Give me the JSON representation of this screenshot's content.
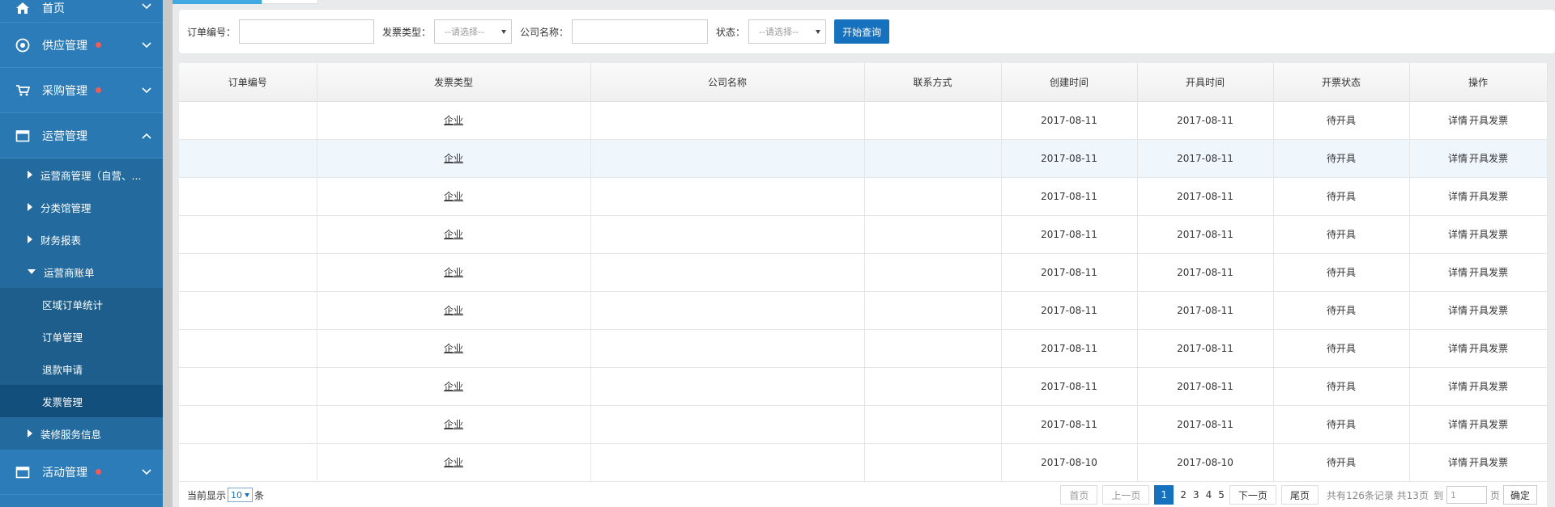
{
  "sidebar": {
    "home": "首页",
    "supply": "供应管理",
    "purchase": "采购管理",
    "operations": "运营管理",
    "operations_children": {
      "operator_mgmt": "运营商管理（自营、...",
      "category_mgmt": "分类馆管理",
      "finance": "财务报表",
      "operator_bill": "运营商账单",
      "bill_children": [
        "区域订单统计",
        "订单管理",
        "退款申请",
        "发票管理"
      ],
      "decoration": "装修服务信息"
    },
    "activity": "活动管理"
  },
  "filters": {
    "order_no_label": "订单编号：",
    "invoice_type_label": "发票类型：",
    "invoice_type_value": "--请选择--",
    "company_label": "公司名称：",
    "status_label": "状态：",
    "status_value": "--请选择--",
    "query_button": "开始查询"
  },
  "table": {
    "headers": [
      "订单编号",
      "发票类型",
      "公司名称",
      "联系方式",
      "创建时间",
      "开具时间",
      "开票状态",
      "操作"
    ],
    "rows": [
      {
        "order_no": "",
        "type": "企业",
        "company": "",
        "contact": "",
        "created": "2017-08-11",
        "issued": "2017-08-11",
        "status": "待开具"
      },
      {
        "order_no": "",
        "type": "企业",
        "company": "",
        "contact": "",
        "created": "2017-08-11",
        "issued": "2017-08-11",
        "status": "待开具"
      },
      {
        "order_no": "",
        "type": "企业",
        "company": "",
        "contact": "",
        "created": "2017-08-11",
        "issued": "2017-08-11",
        "status": "待开具"
      },
      {
        "order_no": "",
        "type": "企业",
        "company": "",
        "contact": "",
        "created": "2017-08-11",
        "issued": "2017-08-11",
        "status": "待开具"
      },
      {
        "order_no": "",
        "type": "企业",
        "company": "",
        "contact": "",
        "created": "2017-08-11",
        "issued": "2017-08-11",
        "status": "待开具"
      },
      {
        "order_no": "",
        "type": "企业",
        "company": "",
        "contact": "",
        "created": "2017-08-11",
        "issued": "2017-08-11",
        "status": "待开具"
      },
      {
        "order_no": "",
        "type": "企业",
        "company": "",
        "contact": "",
        "created": "2017-08-11",
        "issued": "2017-08-11",
        "status": "待开具"
      },
      {
        "order_no": "",
        "type": "企业",
        "company": "",
        "contact": "",
        "created": "2017-08-11",
        "issued": "2017-08-11",
        "status": "待开具"
      },
      {
        "order_no": "",
        "type": "企业",
        "company": "",
        "contact": "",
        "created": "2017-08-11",
        "issued": "2017-08-11",
        "status": "待开具"
      },
      {
        "order_no": "",
        "type": "企业",
        "company": "",
        "contact": "",
        "created": "2017-08-10",
        "issued": "2017-08-10",
        "status": "待开具"
      }
    ],
    "action_detail": "详情",
    "action_issue": "开具发票"
  },
  "pagination": {
    "showing_prefix": "当前显示",
    "page_size": "10",
    "showing_suffix": "条",
    "first": "首页",
    "prev": "上一页",
    "pages": [
      "1",
      "2",
      "3",
      "4",
      "5"
    ],
    "current_page": "1",
    "next": "下一页",
    "last": "尾页",
    "summary": "共有126条记录 共13页",
    "goto_label": "到",
    "goto_value": "1",
    "page_unit": "页",
    "confirm": "确定"
  },
  "colors": {
    "sidebar_bg": "#2b7cb8",
    "submenu_bg": "#1d5e8c",
    "accent": "#1672be",
    "dot": "#ef5b5b"
  },
  "icons": [
    "home-icon",
    "supply-icon",
    "cart-icon",
    "calendar-icon",
    "activity-icon",
    "chevron-down-icon",
    "chevron-up-icon"
  ]
}
